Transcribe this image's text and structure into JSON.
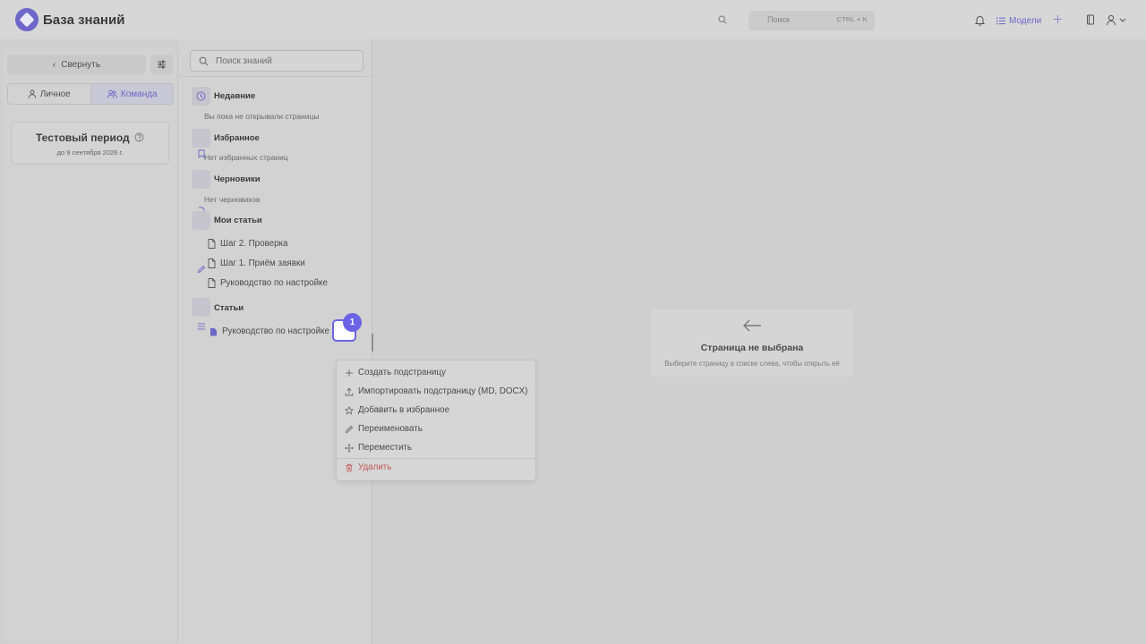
{
  "header": {
    "title": "База знаний",
    "search_placeholder": "Поиск",
    "search_shortcut": "CTRL + K",
    "models_label": "Модели"
  },
  "left": {
    "collapse_label": "Свернуть",
    "tabs": [
      {
        "label": "Личное",
        "icon": "user-icon"
      },
      {
        "label": "Команда",
        "icon": "team-icon",
        "active": true
      }
    ],
    "trial": {
      "title": "Тестовый период",
      "until": "до 9 сентября 2026 г."
    }
  },
  "tree": {
    "search_placeholder": "Поиск знаний",
    "sections": {
      "recent": {
        "title": "Недавние",
        "empty": "Вы пока не открывали страницы"
      },
      "favorites": {
        "title": "Избранное",
        "empty": "Нет избранных страниц"
      },
      "drafts": {
        "title": "Черновики",
        "empty": "Нет черновиков"
      },
      "my_articles": {
        "title": "Мои статьи",
        "items": [
          "Шаг 2. Проверка",
          "Шаг 1. Приём заявки",
          "Руководство по настройке"
        ]
      },
      "articles": {
        "title": "Статьи",
        "items": [
          "Руководство по настройке"
        ]
      }
    }
  },
  "step_badge": "1",
  "context_menu": {
    "items": [
      {
        "label": "Создать подстраницу",
        "icon": "plus-icon"
      },
      {
        "label": "Импортировать подстраницу (MD, DOCX)",
        "icon": "upload-icon"
      },
      {
        "label": "Добавить в избранное",
        "icon": "star-icon"
      },
      {
        "label": "Переименовать",
        "icon": "pencil-icon"
      },
      {
        "label": "Переместить",
        "icon": "move-icon"
      },
      {
        "label": "Удалить",
        "icon": "trash-icon",
        "danger": true
      }
    ]
  },
  "empty_state": {
    "title": "Страница не выбрана",
    "subtitle": "Выберите страницу в списке слева, чтобы открыть её"
  },
  "colors": {
    "accent": "#6d66c8",
    "danger": "#c55a5a",
    "badge": "#6a63e6"
  }
}
